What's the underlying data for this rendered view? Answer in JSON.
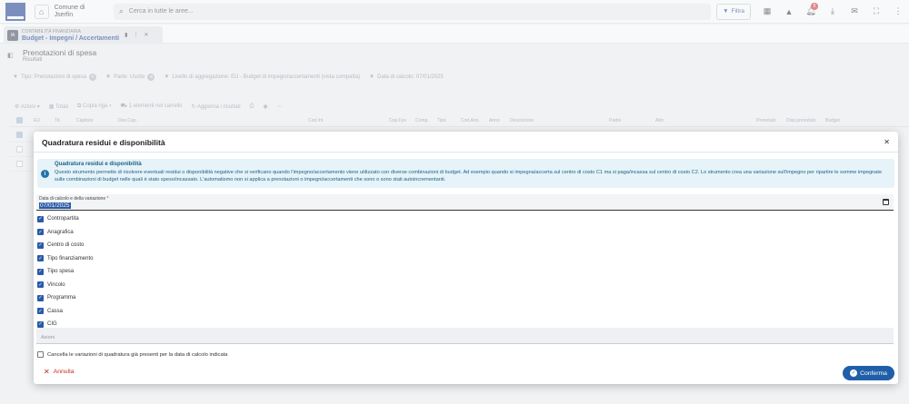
{
  "topbar": {
    "org_line1": "Comune di",
    "org_line2": "Jserfin",
    "search_placeholder": "Cerca in tutte le aree...",
    "filter_label": "Filtra",
    "notification_count": "8"
  },
  "tab": {
    "module": "CONTABILITÀ FINANZIARIA",
    "title": "Budget - Impegni / Accertamenti",
    "icon_text": "IA"
  },
  "page": {
    "title": "Prenotazioni di spesa",
    "subtitle": "Risultati"
  },
  "chips": [
    "Tipo: Prenotazioni di spesa",
    "Parte: Uscite",
    "Livello di aggregazione: EU - Budget di impegni/accertamenti (vista compatta)",
    "Data di calcolo: 07/01/2025"
  ],
  "toolbar": {
    "azioni": "Azioni",
    "totali": "Totali",
    "copia_riga": "Copia riga",
    "carrello": "1 elementi nel carrello",
    "aggiorna": "Aggiorna i risultati"
  },
  "grid_columns": [
    "EU",
    "Tit.",
    "Capitolo",
    "Des.Cap.",
    "Cod.Int.",
    "Cop.Fpv",
    "Comp.",
    "Tipo",
    "Cod.Ann.",
    "Anno",
    "Descrizione",
    "Padre",
    "Atto",
    "Prenotato",
    "Disp.prenotato",
    "Budget"
  ],
  "modal": {
    "title": "Quadratura residui e disponibilità",
    "info_title": "Quadratura residui e disponibilità",
    "info_body": "Questo strumento permette di risolvere eventuali residui o disponibilità negative che si verificano quando l'impegno/accertamento viene utilizzato con diverse combinazioni di budget. Ad esempio quando si impegna/accerta sul centro di costo C1 ma si paga/incassa sul centro di costo C2. Lo strumento crea una variazione sull'impegno per ripartire le somme impegnate sulle combinazioni di budget nelle quali è stato speso/incassato. L'automatismo non si applica a prenotazioni o impegni/accertamenti che sono o sono stati autoincrementanti.",
    "date_label": "Data di calcolo e della variazione",
    "date_required_mark": "*",
    "date_value": "07/01/2025",
    "checks": [
      {
        "label": "Contropartita",
        "checked": true
      },
      {
        "label": "Anagrafica",
        "checked": true
      },
      {
        "label": "Centro di costo",
        "checked": true
      },
      {
        "label": "Tipo finanziamento",
        "checked": true
      },
      {
        "label": "Tipo spesa",
        "checked": true
      },
      {
        "label": "Vincolo",
        "checked": true
      },
      {
        "label": "Programma",
        "checked": true
      },
      {
        "label": "Cassa",
        "checked": true
      },
      {
        "label": "CIG",
        "checked": true
      }
    ],
    "actions_placeholder": "Azioni",
    "cancel_label": "Cancella le variazioni di quadratura già presenti per la data di calcolo indicata",
    "annulla": "Annulla",
    "conferma": "Conferma"
  }
}
